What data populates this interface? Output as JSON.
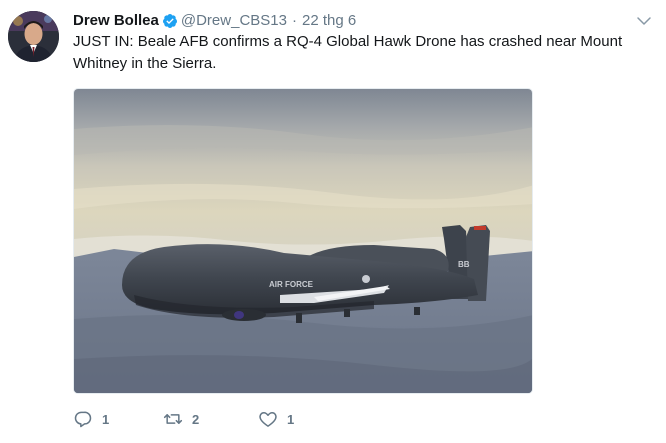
{
  "tweet": {
    "author": {
      "display_name": "Drew Bollea",
      "handle": "@Drew_CBS13",
      "verified": true
    },
    "separator": "·",
    "timestamp": "22 thg 6",
    "text": "JUST IN: Beale AFB confirms a RQ-4 Global Hawk Drone has crashed near Mount Whitney in the Sierra.",
    "media": {
      "description_icon": "drone-photo",
      "aircraft_markings": {
        "fuselage": "AIR FORCE",
        "tail": "BB"
      }
    },
    "actions": {
      "reply_count": "1",
      "retweet_count": "2",
      "like_count": "1"
    }
  },
  "colors": {
    "text_primary": "#14171a",
    "text_secondary": "#657786",
    "verified_blue": "#1da1f2",
    "border": "#e6ecf0"
  },
  "icons": {
    "verified": "verified-badge-icon",
    "caret": "chevron-down-icon",
    "reply": "reply-icon",
    "retweet": "retweet-icon",
    "like": "heart-icon"
  }
}
